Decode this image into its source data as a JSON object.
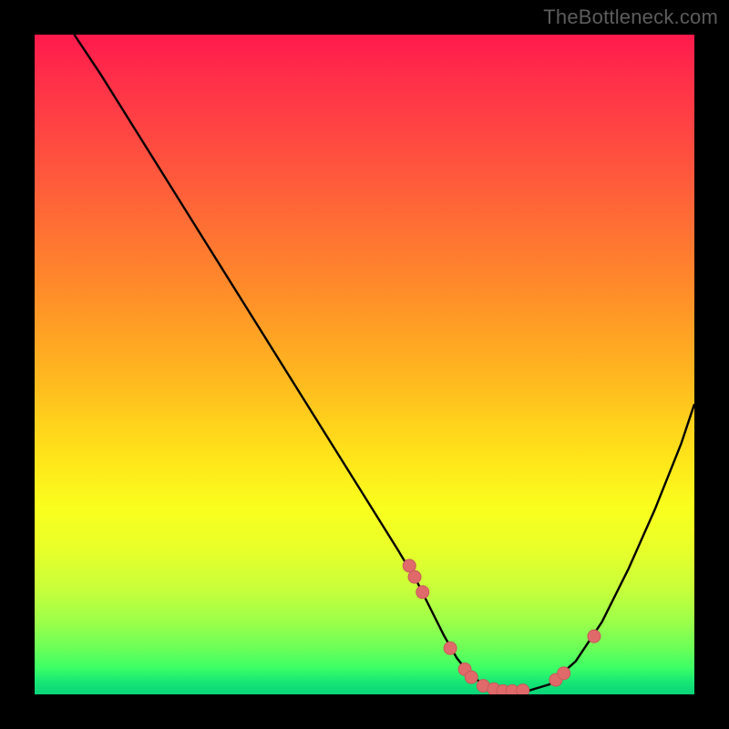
{
  "watermark": "TheBottleneck.com",
  "chart_data": {
    "type": "line",
    "title": "",
    "xlabel": "",
    "ylabel": "",
    "xlim": [
      0,
      100
    ],
    "ylim": [
      0,
      100
    ],
    "grid": false,
    "legend": false,
    "series": [
      {
        "name": "curve",
        "x": [
          6,
          10,
          15,
          20,
          25,
          30,
          35,
          40,
          45,
          50,
          55,
          58,
          60,
          62,
          64,
          66,
          68,
          70,
          72,
          75,
          78,
          82,
          86,
          90,
          94,
          98,
          100
        ],
        "y": [
          100,
          94,
          86,
          78,
          70,
          62,
          54,
          46,
          38,
          30,
          22,
          17,
          13,
          9,
          5.5,
          3,
          1.5,
          0.8,
          0.5,
          0.6,
          1.5,
          5,
          11,
          19,
          28,
          38,
          44
        ]
      }
    ],
    "marker_points": {
      "name": "dots",
      "x": [
        56.8,
        57.6,
        58.8,
        63.0,
        65.2,
        66.2,
        68.0,
        69.6,
        71.0,
        72.4,
        74.0,
        79.0,
        80.2,
        84.8
      ],
      "y": [
        19.5,
        17.8,
        15.5,
        7.0,
        3.8,
        2.6,
        1.3,
        0.8,
        0.5,
        0.5,
        0.6,
        2.2,
        3.2,
        8.8
      ]
    },
    "colors": {
      "line": "#000000",
      "marker_fill": "#e06a6a",
      "marker_stroke": "#c85a5a"
    }
  }
}
